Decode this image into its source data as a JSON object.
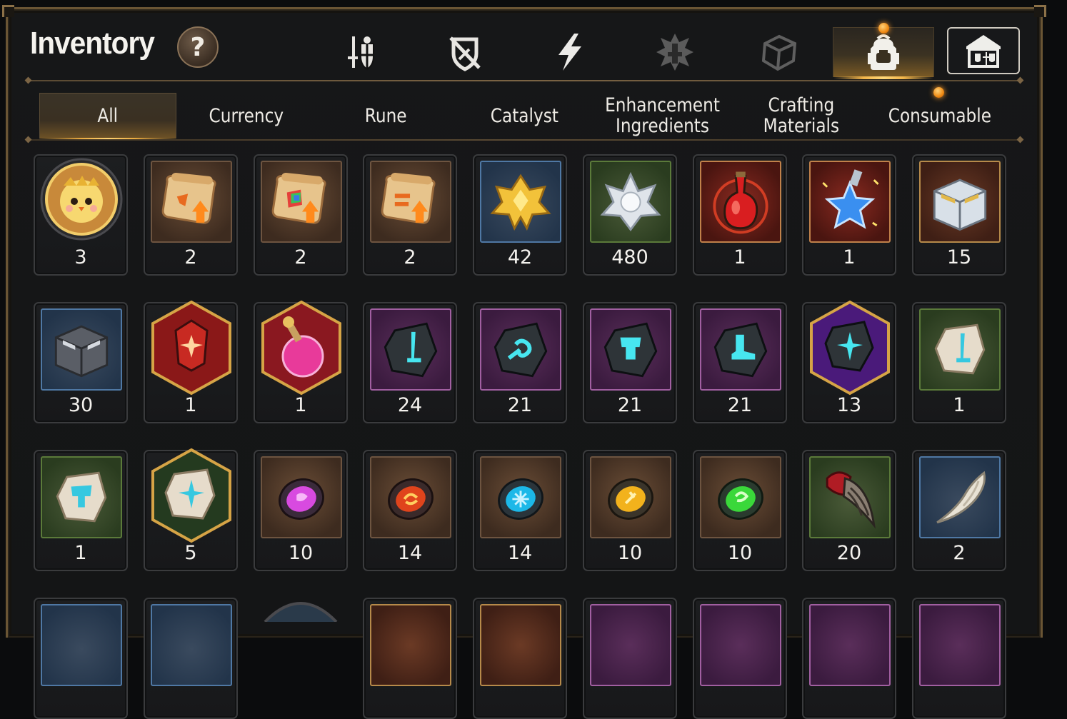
{
  "header": {
    "title": "Inventory",
    "help_label": "?"
  },
  "category_tabs": [
    {
      "icon": "sword-shield-icon",
      "active": false
    },
    {
      "icon": "broken-shield-icon",
      "active": false
    },
    {
      "icon": "lightning-icon",
      "active": false
    },
    {
      "icon": "spiked-emblem-icon",
      "active": false
    },
    {
      "icon": "cube-crate-icon",
      "active": false
    },
    {
      "icon": "backpack-icon",
      "active": true,
      "notify": true
    },
    {
      "icon": "armory-building-icon",
      "active": false
    }
  ],
  "sub_tabs": [
    {
      "label": "All",
      "active": true
    },
    {
      "label": "Currency"
    },
    {
      "label": "Rune"
    },
    {
      "label": "Catalyst"
    },
    {
      "label": "Enhancement Ingredients"
    },
    {
      "label": "Crafting Materials"
    },
    {
      "label": "Consumable",
      "notify": true
    }
  ],
  "items": [
    [
      {
        "icon": "chick-portrait-token-icon",
        "count": "3"
      },
      {
        "icon": "scroll-upgrade-icon",
        "count": "2"
      },
      {
        "icon": "rainbow-scroll-upgrade-icon",
        "count": "2"
      },
      {
        "icon": "scroll-upgrade-icon",
        "count": "2"
      },
      {
        "icon": "gold-crystal-cluster-icon",
        "count": "42"
      },
      {
        "icon": "silver-crystal-flower-icon",
        "count": "480"
      },
      {
        "icon": "red-potion-icon",
        "count": "1"
      },
      {
        "icon": "blue-star-potion-icon",
        "count": "1"
      },
      {
        "icon": "silver-chest-icon",
        "count": "15"
      }
    ],
    [
      {
        "icon": "dark-chest-icon",
        "count": "30"
      },
      {
        "icon": "red-crest-stone-icon",
        "count": "1"
      },
      {
        "icon": "pink-orb-potion-icon",
        "count": "1"
      },
      {
        "icon": "sword-rune-stone-icon",
        "count": "24"
      },
      {
        "icon": "spiral-rune-stone-icon",
        "count": "21"
      },
      {
        "icon": "armor-rune-stone-icon",
        "count": "21"
      },
      {
        "icon": "boot-rune-stone-icon",
        "count": "21"
      },
      {
        "icon": "star-rune-stone-icon",
        "count": "13"
      },
      {
        "icon": "sword-rune-tablet-icon",
        "count": "1"
      }
    ],
    [
      {
        "icon": "shield-rune-tablet-icon",
        "count": "1"
      },
      {
        "icon": "star-rune-tablet-icon",
        "count": "5"
      },
      {
        "icon": "purple-catalyst-gem-icon",
        "count": "10"
      },
      {
        "icon": "red-catalyst-gem-icon",
        "count": "14"
      },
      {
        "icon": "cyan-catalyst-gem-icon",
        "count": "14"
      },
      {
        "icon": "yellow-catalyst-gem-icon",
        "count": "10"
      },
      {
        "icon": "green-catalyst-gem-icon",
        "count": "10"
      },
      {
        "icon": "crimson-claw-icon",
        "count": "20"
      },
      {
        "icon": "bone-fang-icon",
        "count": "2"
      }
    ]
  ],
  "colors": {
    "frame_gold": "#6a5534",
    "active_glow": "#f2b54a",
    "notify_orange": "#f08a12"
  }
}
